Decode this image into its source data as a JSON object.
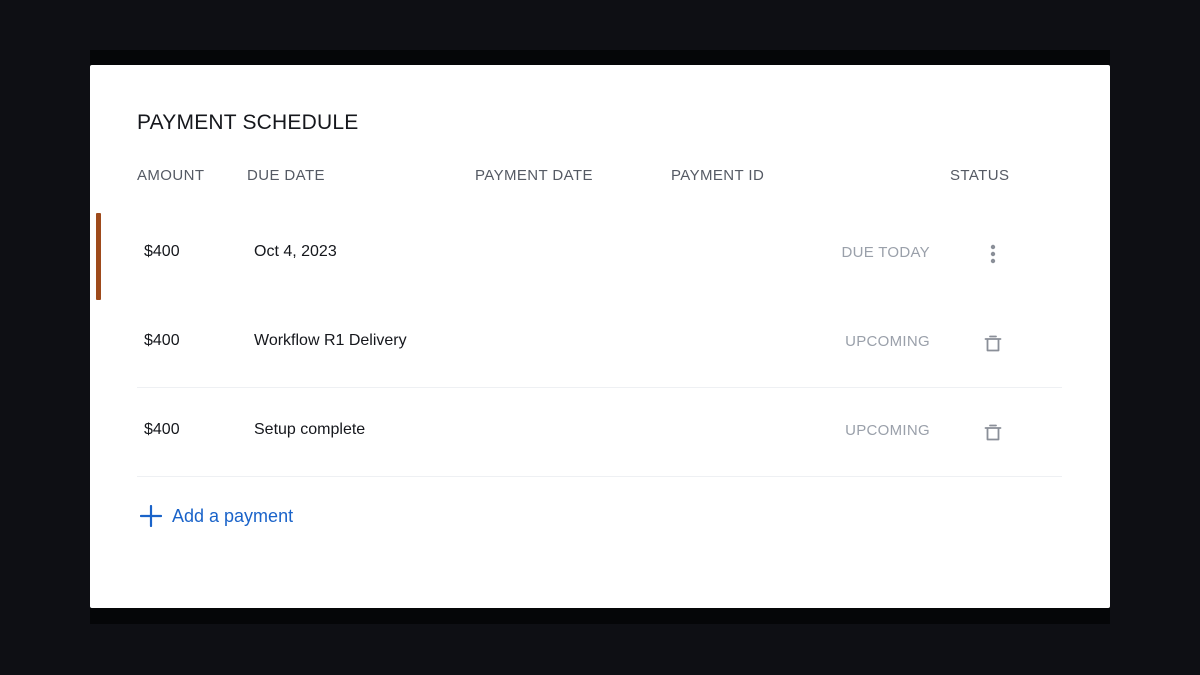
{
  "schedule": {
    "title": "PAYMENT SCHEDULE",
    "columns": {
      "amount": "AMOUNT",
      "due_date": "DUE DATE",
      "payment_date": "PAYMENT DATE",
      "payment_id": "PAYMENT ID",
      "status": "STATUS"
    },
    "rows": [
      {
        "amount": "$400",
        "due": "Oct 4, 2023",
        "payment_date": "",
        "payment_id": "",
        "status": "DUE TODAY",
        "action_icon": "more-vertical-icon",
        "highlighted": true
      },
      {
        "amount": "$400",
        "due": "Workflow R1 Delivery",
        "payment_date": "",
        "payment_id": "",
        "status": "UPCOMING",
        "action_icon": "trash-icon",
        "highlighted": false
      },
      {
        "amount": "$400",
        "due": "Setup complete",
        "payment_date": "",
        "payment_id": "",
        "status": "UPCOMING",
        "action_icon": "trash-icon",
        "highlighted": false
      }
    ],
    "add_button_label": "Add a payment",
    "add_icon": "plus-icon"
  },
  "colors": {
    "accent_bar": "#9e4a1b",
    "link_blue": "#1a63c9",
    "status_gray": "#9aa0aa"
  }
}
